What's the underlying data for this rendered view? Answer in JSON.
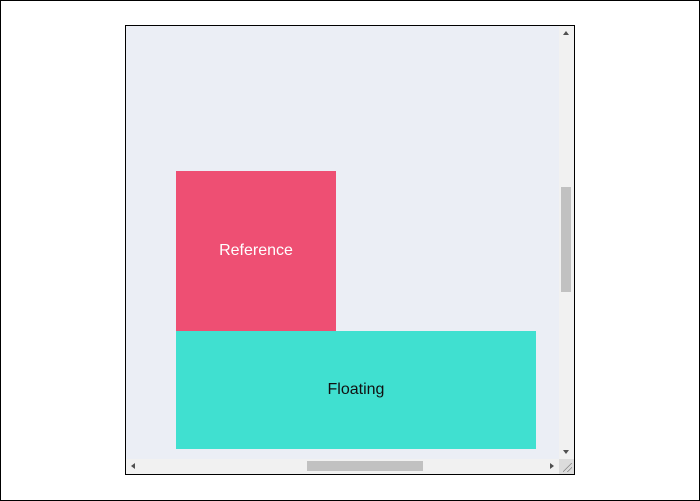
{
  "viewport": {
    "reference_label": "Reference",
    "floating_label": "Floating"
  },
  "colors": {
    "page_background": "#ffffff",
    "container_background": "#ebeef5",
    "reference": "#ee4f73",
    "floating": "#40e0d0",
    "scrollbar_track": "#f1f1f1",
    "scrollbar_thumb": "#c1c1c1"
  },
  "scroll": {
    "vertical_position_fraction": 0.39,
    "horizontal_position_fraction": 0.46
  },
  "icons": {
    "scroll_up": "triangle-up-icon",
    "scroll_down": "triangle-down-icon",
    "scroll_left": "triangle-left-icon",
    "scroll_right": "triangle-right-icon",
    "resize": "resize-grip-icon"
  }
}
